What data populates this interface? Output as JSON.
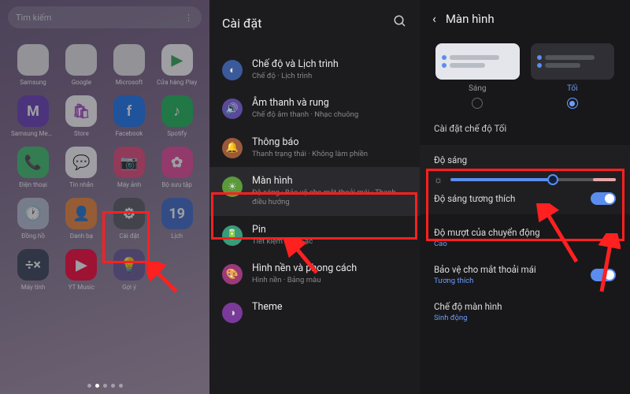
{
  "panel1": {
    "search_placeholder": "Tìm kiếm",
    "apps": [
      {
        "label": "Samsung",
        "bg": "#eaeaea",
        "glyph": ""
      },
      {
        "label": "Google",
        "bg": "#eaeaea",
        "glyph": ""
      },
      {
        "label": "Microsoft",
        "bg": "#eaeaea",
        "glyph": ""
      },
      {
        "label": "Cửa hàng Play",
        "bg": "#ffffff",
        "glyph": "▶",
        "fg": "#34a853"
      },
      {
        "label": "Samsung Memb..",
        "bg": "#6b3fb8",
        "glyph": "M"
      },
      {
        "label": "Store",
        "bg": "#ffffff",
        "glyph": "🛍",
        "fg": "#a84cc4"
      },
      {
        "label": "Facebook",
        "bg": "#1877f2",
        "glyph": "f"
      },
      {
        "label": "Spotify",
        "bg": "#1db954",
        "glyph": "♪"
      },
      {
        "label": "Điện thoại",
        "bg": "#3ec46d",
        "glyph": "📞"
      },
      {
        "label": "Tin nhắn",
        "bg": "#ffffff",
        "glyph": "💬",
        "fg": "#3a7de0"
      },
      {
        "label": "Máy ảnh",
        "bg": "#e84a7a",
        "glyph": "📷"
      },
      {
        "label": "Bộ sưu tập",
        "bg": "#e84a9a",
        "glyph": "✿"
      },
      {
        "label": "Đồng hồ",
        "bg": "#b8c2d4",
        "glyph": "🕐"
      },
      {
        "label": "Danh bạ",
        "bg": "#f08838",
        "glyph": "👤"
      },
      {
        "label": "Cài đặt",
        "bg": "#5a5a60",
        "glyph": "⚙"
      },
      {
        "label": "Lịch",
        "bg": "#3d6bc9",
        "glyph": "19"
      },
      {
        "label": "Máy tính",
        "bg": "#3a4356",
        "glyph": "÷×"
      },
      {
        "label": "YT Music",
        "bg": "#ff0033",
        "glyph": "▶"
      },
      {
        "label": "Gợi ý",
        "bg": "#6a5a9a",
        "glyph": "💡"
      }
    ]
  },
  "panel2": {
    "title": "Cài đặt",
    "items": [
      {
        "icon_bg": "#3a5a9a",
        "glyph": "◐",
        "title": "Chế độ và Lịch trình",
        "sub": "Chế độ · Lịch trình"
      },
      {
        "icon_bg": "#5a4a9a",
        "glyph": "🔊",
        "title": "Âm thanh và rung",
        "sub": "Chế độ âm thanh · Nhạc chuông"
      },
      {
        "icon_bg": "#9a5a3a",
        "glyph": "🔔",
        "title": "Thông báo",
        "sub": "Thanh trạng thái · Không làm phiền"
      },
      {
        "icon_bg": "#5a9a3a",
        "glyph": "☀",
        "title": "Màn hình",
        "sub": "Độ sáng · Bảo vệ cho mắt thoải mái · Thanh điều hướng"
      },
      {
        "icon_bg": "#3a9a7a",
        "glyph": "🔋",
        "title": "Pin",
        "sub": "Tiết kiệm pin · Sạc"
      },
      {
        "icon_bg": "#9a3a7a",
        "glyph": "🎨",
        "title": "Hình nền và phong cách",
        "sub": "Hình nền · Bảng màu"
      },
      {
        "icon_bg": "#7a3a9a",
        "glyph": "◑",
        "title": "Theme",
        "sub": ""
      }
    ]
  },
  "panel3": {
    "title": "Màn hình",
    "mode_light": "Sáng",
    "mode_dark": "Tối",
    "dark_settings": "Cài đặt chế độ Tối",
    "brightness": "Độ sáng",
    "adaptive": "Độ sáng tương thích",
    "motion_title": "Độ mượt của chuyển động",
    "motion_sub": "Cao",
    "eye_title": "Bảo vệ cho mắt thoải mái",
    "eye_sub": "Tương thích",
    "screen_mode_title": "Chế độ màn hình",
    "screen_mode_sub": "Sinh động"
  }
}
